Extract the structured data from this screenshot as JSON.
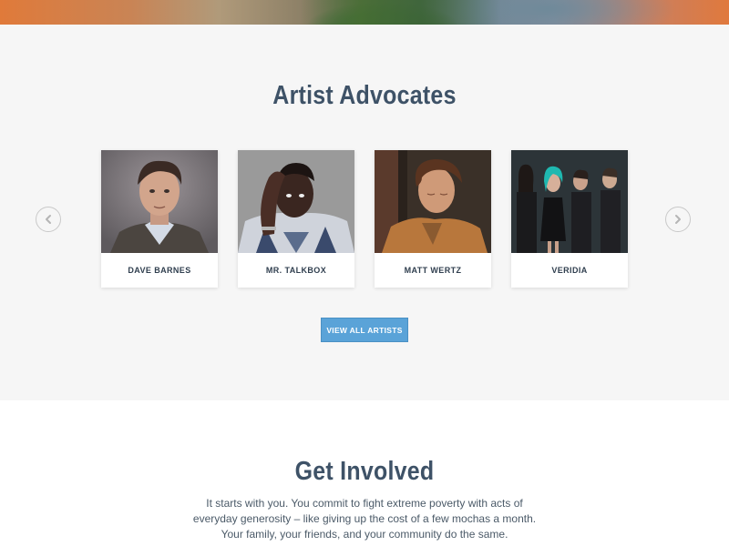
{
  "artists": {
    "title": "Artist Advocates",
    "cards": [
      {
        "name": "DAVE BARNES"
      },
      {
        "name": "MR. TALKBOX"
      },
      {
        "name": "MATT WERTZ"
      },
      {
        "name": "VERIDIA"
      }
    ],
    "view_all_label": "VIEW ALL ARTISTS",
    "prev_icon": "chevron-left-icon",
    "next_icon": "chevron-right-icon"
  },
  "involved": {
    "title": "Get Involved",
    "lines": [
      "It starts with you. You commit to fight extreme poverty with acts of",
      "everyday generosity – like giving up the cost of a few mochas a month.",
      "Your family, your friends, and your community do the same."
    ]
  },
  "colors": {
    "section_bg": "#f6f6f6",
    "heading": "#3e5267",
    "button": "#5aa3d8"
  }
}
